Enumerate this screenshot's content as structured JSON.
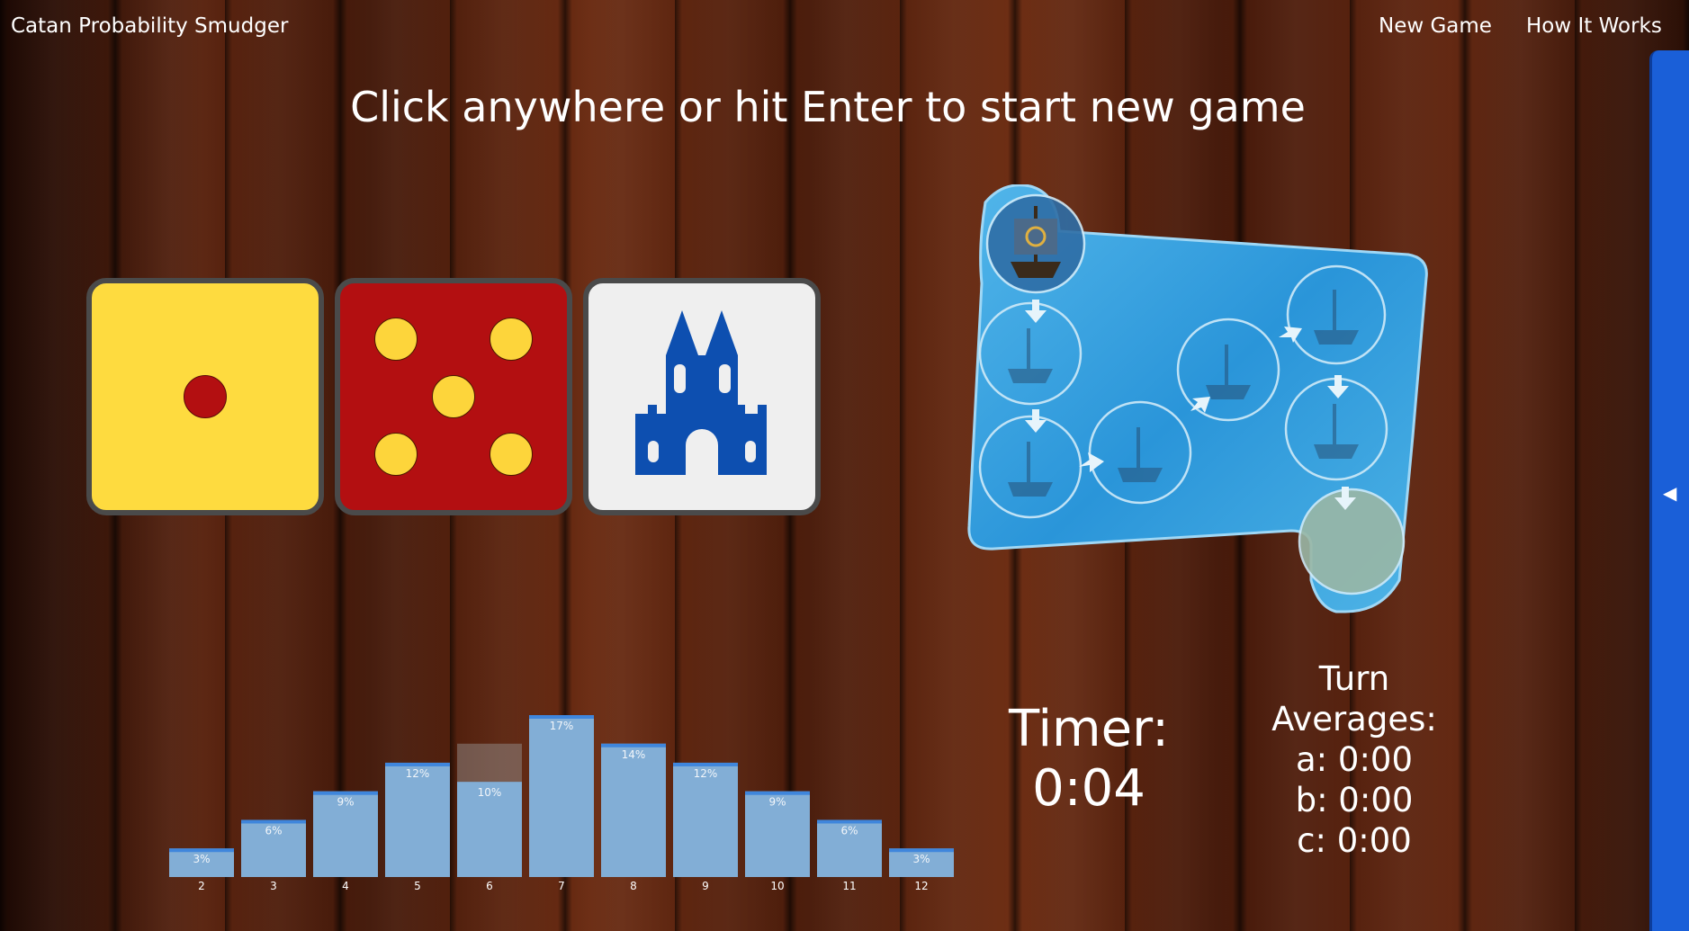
{
  "app": {
    "brand": "Catan Probability Smudger",
    "nav": {
      "new_game": "New Game",
      "how_it_works": "How It Works"
    }
  },
  "side_tab": {
    "arrow_icon": "chevron-left-icon",
    "glyph": "◀",
    "color": "#1a5fd8"
  },
  "headline": "Click anywhere or hit Enter to start new game",
  "dice": {
    "yellow": {
      "value": 1,
      "color": "#fedb3f",
      "pip_color": "#b30f11"
    },
    "red": {
      "value": 5,
      "color": "#b30f11",
      "pip_color": "#fdd53b"
    },
    "event": {
      "face": "city-gate-icon",
      "color": "#0d4fb0"
    }
  },
  "barbarian_track": {
    "icon": "barbarian-ship-track",
    "steps": 8
  },
  "chart_data": {
    "type": "bar",
    "categories": [
      "2",
      "3",
      "4",
      "5",
      "6",
      "7",
      "8",
      "9",
      "10",
      "11",
      "12"
    ],
    "series": [
      {
        "values": [
          3,
          6,
          9,
          12,
          10,
          17,
          14,
          12,
          9,
          6,
          3
        ]
      },
      {
        "values": [
          3,
          6,
          9,
          12,
          14,
          17,
          14,
          12,
          9,
          6,
          3
        ]
      }
    ],
    "labels": [
      "3%",
      "6%",
      "9%",
      "12%",
      "10%",
      "17%",
      "14%",
      "12%",
      "9%",
      "6%",
      "3%"
    ],
    "highlight_index": 4,
    "ylim": [
      0,
      17
    ],
    "grid": false,
    "bar_color": "#82aed6",
    "cap_color": "#3f86dc"
  },
  "timer": {
    "label": "Timer:",
    "value": "0:04"
  },
  "averages": {
    "title_1": "Turn",
    "title_2": "Averages:",
    "a": "a: 0:00",
    "b": "b: 0:00",
    "c": "c: 0:00"
  }
}
